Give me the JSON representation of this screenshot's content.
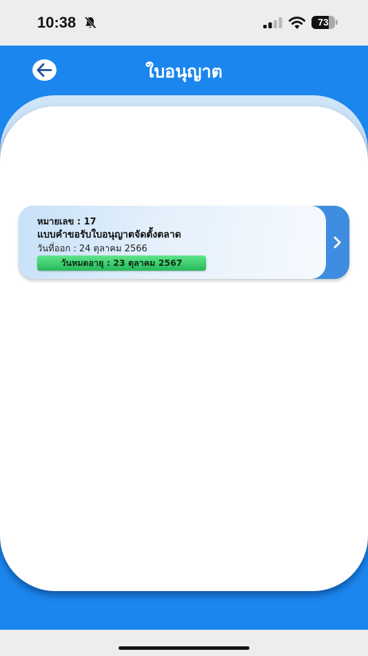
{
  "status_bar": {
    "time": "10:38",
    "battery_level": 73,
    "battery_label": "73"
  },
  "header": {
    "title": "ใบอนุญาต"
  },
  "licenses": [
    {
      "number_label": "หมายเลข : 17",
      "title": "แบบคำขอรับใบอนุญาตจัดตั้งตลาด",
      "issue_date": "วันที่ออก : 24 ตุลาคม 2566",
      "expiry_date": "วันหมดอายุ : 23 ตุลาคม 2567"
    }
  ],
  "colors": {
    "primary_blue": "#1b86ee",
    "card_arrow_blue": "#3e8de0",
    "badge_green": "#25b85a"
  }
}
